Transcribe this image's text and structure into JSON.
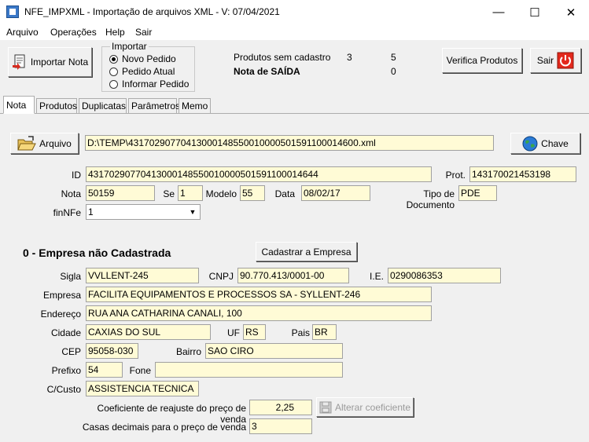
{
  "window": {
    "title": "NFE_IMPXML - Importação de arquivos XML - V: 07/04/2021",
    "minimize_glyph": "—",
    "maximize_glyph": "☐",
    "close_glyph": "✕"
  },
  "menu": [
    "Arquivo",
    "Operações",
    "Help",
    "Sair"
  ],
  "toolbar": {
    "importar_nota": "Importar Nota",
    "importar_group": {
      "title": "Importar",
      "options": [
        "Novo Pedido",
        "Pedido Atual",
        "Informar Pedido"
      ],
      "selected_index": 0
    },
    "produtos_sem_cadastro_label": "Produtos sem cadastro",
    "produtos_sem_cadastro_a": "3",
    "produtos_sem_cadastro_b": "5",
    "nota_saida_label": "Nota de SAÍDA",
    "nota_saida_value": "0",
    "verifica_produtos": "Verifica Produtos",
    "sair": "Sair"
  },
  "tabs": [
    "Nota",
    "Produtos",
    "Duplicatas",
    "Parâmetros",
    "Memo"
  ],
  "active_tab": 0,
  "nota": {
    "arquivo_button": "Arquivo",
    "arquivo_path": "D:\\TEMP\\43170290770413000148550010000501591100014600.xml",
    "chave_button": "Chave",
    "id_label": "ID",
    "id_value": "43170290770413000148550010000501591100014644",
    "prot_label": "Prot.",
    "prot_value": "143170021453198",
    "nota_label": "Nota",
    "nota_value": "50159",
    "se_label": "Se",
    "se_value": "1",
    "modelo_label": "Modelo",
    "modelo_value": "55",
    "data_label": "Data",
    "data_value": "08/02/17",
    "tipo_doc_label": "Tipo de Documento",
    "tipo_doc_value": "PDE",
    "finnfe_label": "finNFe",
    "finnfe_value": "1"
  },
  "empresa": {
    "heading": "0 - Empresa não Cadastrada",
    "cadastrar_button": "Cadastrar a Empresa",
    "sigla_label": "Sigla",
    "sigla_value": "VVLLENT-245",
    "cnpj_label": "CNPJ",
    "cnpj_value": "90.770.413/0001-00",
    "ie_label": "I.E.",
    "ie_value": "0290086353",
    "empresa_label": "Empresa",
    "empresa_value": "FACILITA EQUIPAMENTOS E PROCESSOS SA - SYLLENT-246",
    "endereco_label": "Endereço",
    "endereco_value": "RUA ANA CATHARINA CANALI, 100",
    "cidade_label": "Cidade",
    "cidade_value": "CAXIAS DO SUL",
    "uf_label": "UF",
    "uf_value": "RS",
    "pais_label": "Pais",
    "pais_value": "BR",
    "cep_label": "CEP",
    "cep_value": "95058-030",
    "bairro_label": "Bairro",
    "bairro_value": "SAO CIRO",
    "prefixo_label": "Prefixo",
    "prefixo_value": "54",
    "fone_label": "Fone",
    "fone_value": "",
    "ccusto_label": "C/Custo",
    "ccusto_value": "ASSISTENCIA TECNICA",
    "coef_label": "Coeficiente de reajuste do preço de venda",
    "coef_value": "2,25",
    "alterar_coef_button": "Alterar coeficiente",
    "casas_label": "Casas decimais para o preço de venda",
    "casas_value": "3"
  }
}
